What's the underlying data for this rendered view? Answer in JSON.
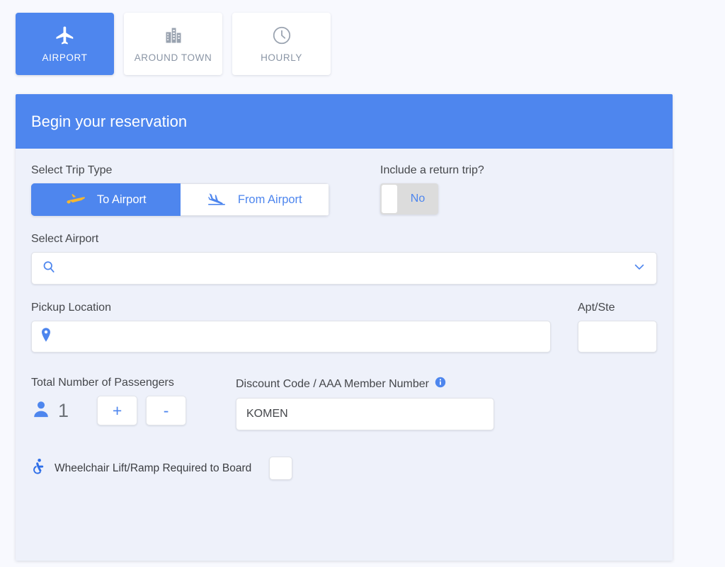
{
  "tabs": [
    {
      "label": "AIRPORT",
      "icon": "airplane-icon",
      "active": true
    },
    {
      "label": "AROUND TOWN",
      "icon": "buildings-icon",
      "active": false
    },
    {
      "label": "HOURLY",
      "icon": "clock-icon",
      "active": false
    }
  ],
  "card": {
    "header_title": "Begin your reservation"
  },
  "trip_type": {
    "label": "Select Trip Type",
    "options": [
      {
        "label": "To Airport",
        "icon": "plane-takeoff-icon",
        "selected": true
      },
      {
        "label": "From Airport",
        "icon": "plane-landing-icon",
        "selected": false
      }
    ]
  },
  "return_trip": {
    "label": "Include a return trip?",
    "value": "No"
  },
  "airport": {
    "label": "Select Airport",
    "value": "",
    "placeholder": "",
    "search_icon": "search-icon",
    "chevron_icon": "chevron-down-icon"
  },
  "pickup": {
    "label": "Pickup Location",
    "value": "",
    "placeholder": "",
    "pin_icon": "map-pin-icon"
  },
  "apt": {
    "label": "Apt/Ste",
    "value": "",
    "placeholder": ""
  },
  "passengers": {
    "label": "Total Number of Passengers",
    "count": "1",
    "person_icon": "person-icon",
    "increment_label": "+",
    "decrement_label": "-"
  },
  "discount": {
    "label": "Discount Code / AAA Member Number",
    "info_icon": "info-icon",
    "value": "KOMEN",
    "placeholder": ""
  },
  "wheelchair": {
    "label": "Wheelchair Lift/Ramp Required to Board",
    "icon": "wheelchair-accessible-icon",
    "checked": false
  },
  "colors": {
    "accent_blue": "#4e86ee",
    "header_blue": "#4e86ee",
    "card_body": "#eef1fa",
    "page_background": "#f8f9fe",
    "inactive_gray": "#8a95a5",
    "plane_yellow": "#f5b731"
  }
}
